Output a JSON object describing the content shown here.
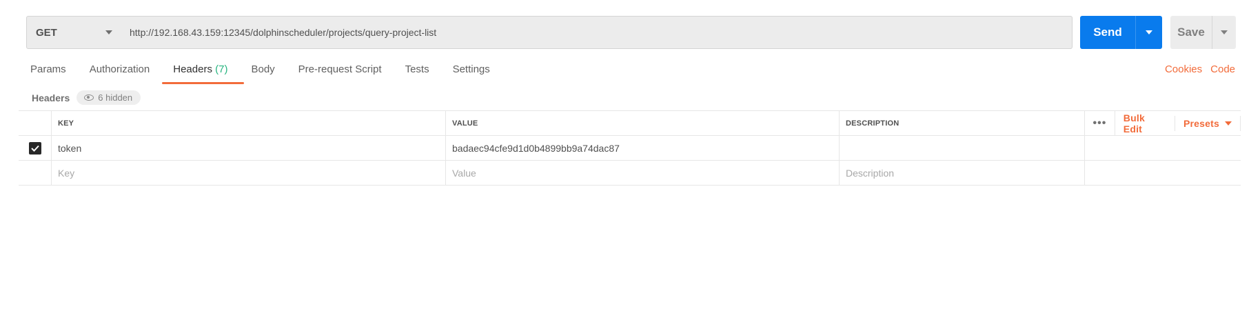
{
  "request": {
    "method": "GET",
    "url": "http://192.168.43.159:12345/dolphinscheduler/projects/query-project-list",
    "send_label": "Send",
    "save_label": "Save"
  },
  "tabs": [
    {
      "label": "Params"
    },
    {
      "label": "Authorization"
    },
    {
      "label": "Headers",
      "count": "(7)"
    },
    {
      "label": "Body"
    },
    {
      "label": "Pre-request Script"
    },
    {
      "label": "Tests"
    },
    {
      "label": "Settings"
    }
  ],
  "right_links": {
    "cookies": "Cookies",
    "code": "Code"
  },
  "headers_section": {
    "title": "Headers",
    "hidden_label": "6 hidden"
  },
  "table": {
    "columns": {
      "key": "KEY",
      "value": "VALUE",
      "description": "DESCRIPTION"
    },
    "actions": {
      "dots": "•••",
      "bulk_edit": "Bulk Edit",
      "presets": "Presets"
    },
    "rows": [
      {
        "checked": true,
        "key": "token",
        "value": "badaec94cfe9d1d0b4899bb9a74dac87",
        "description": ""
      }
    ],
    "placeholders": {
      "key": "Key",
      "value": "Value",
      "description": "Description"
    }
  },
  "colors": {
    "accent": "#f26b3a",
    "send": "#097bed",
    "count": "#26b47f"
  }
}
